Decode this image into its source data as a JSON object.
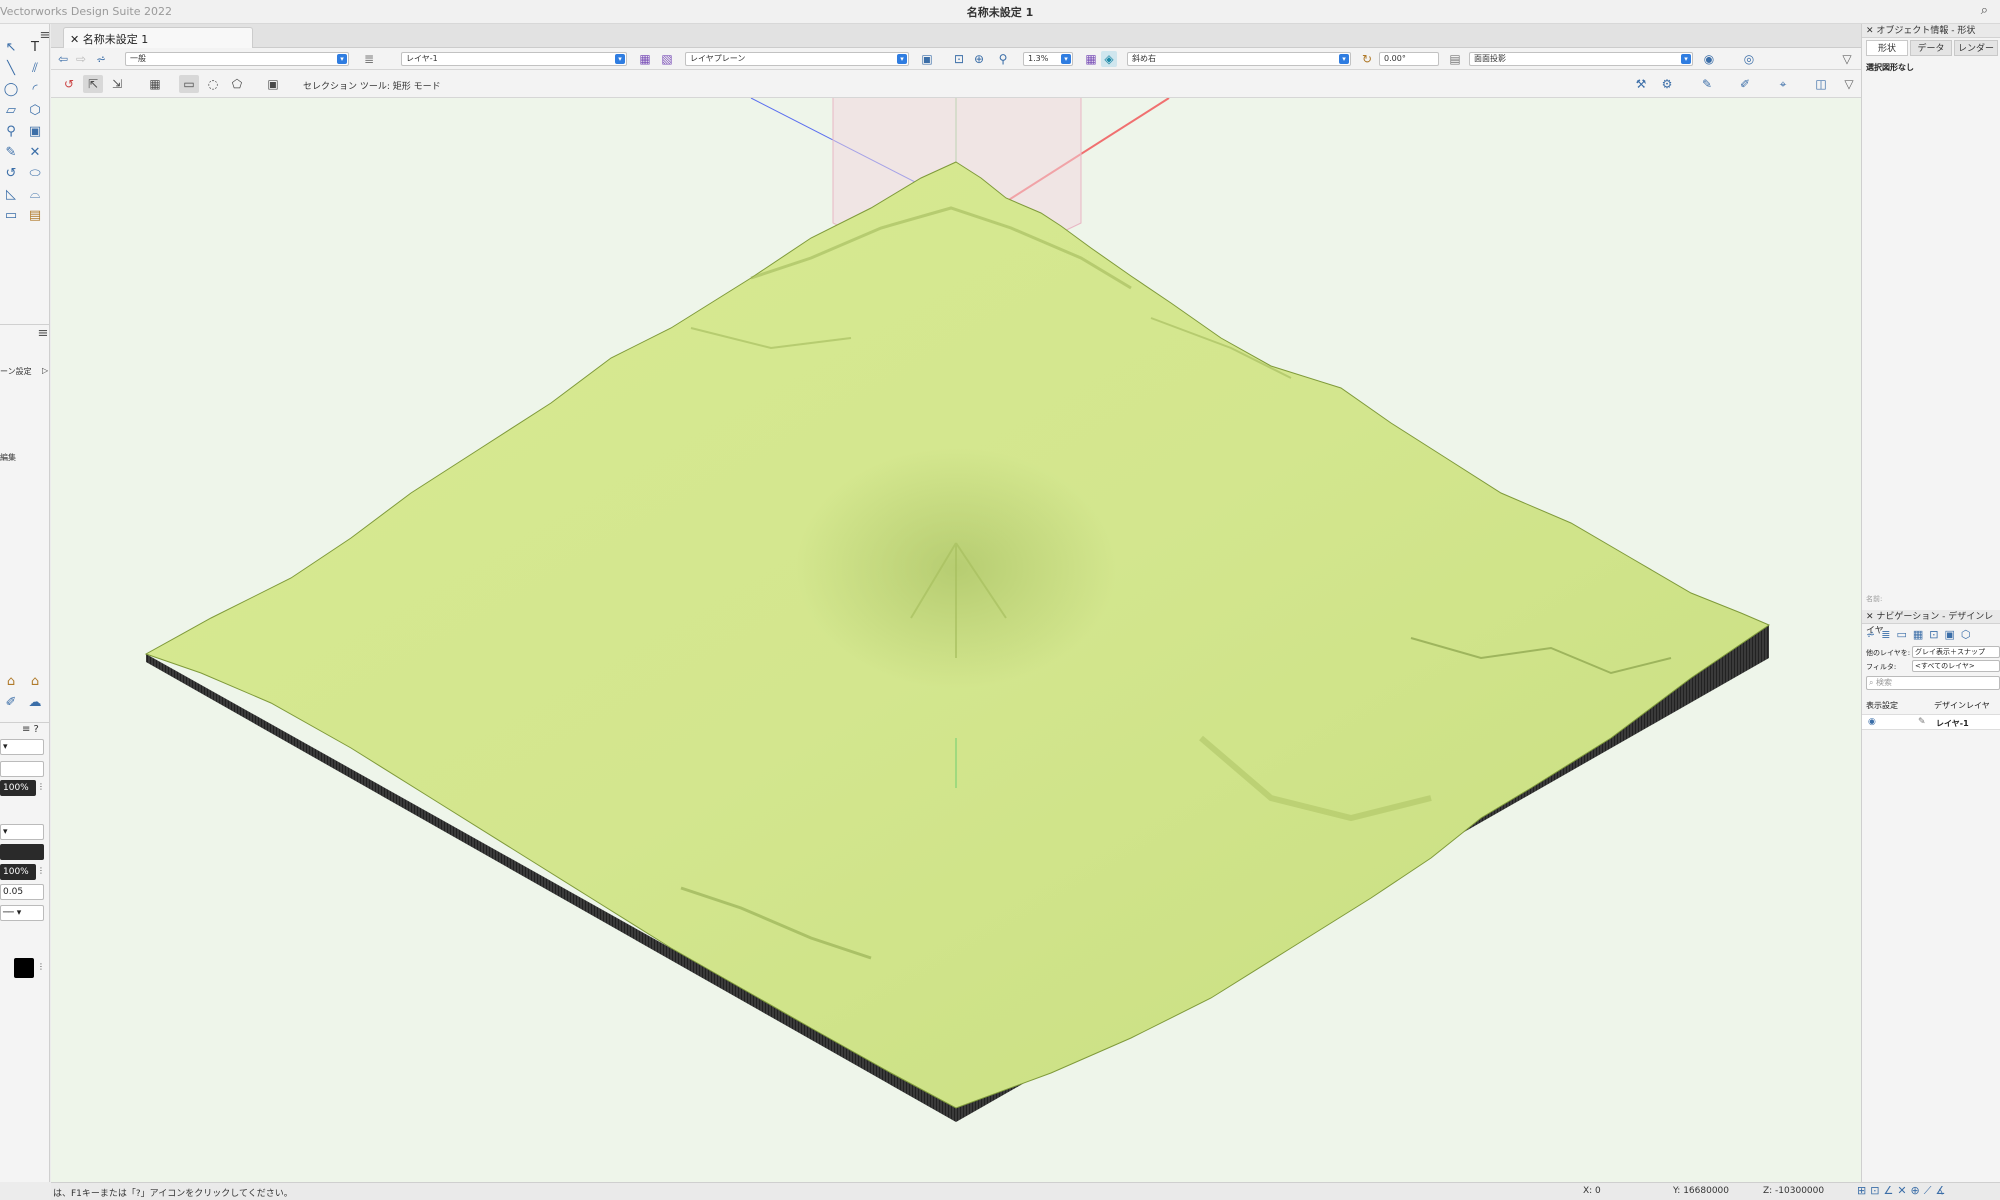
{
  "app": {
    "title": "Vectorworks Design Suite 2022",
    "document_title": "名称未設定 1"
  },
  "tab": {
    "label": "名称未設定 1"
  },
  "viewbar": {
    "class_value": "一般",
    "layer_value": "レイヤ-1",
    "plane_value": "レイヤプレーン",
    "zoom_value": "1.3%",
    "view_value": "斜め右",
    "angle_value": "0.00°",
    "render_value": "面面投影"
  },
  "modebar": {
    "mode_text": "セレクション ツール: 矩形 モード"
  },
  "leftpanel": {
    "item1": "ーン設定",
    "item2": "編集",
    "opacity1": "100%",
    "opacity2": "100%",
    "line_weight": "0.05"
  },
  "rightpanel": {
    "obj_info_title": "オブジェクト情報 - 形状",
    "tabs": [
      "形状",
      "データ",
      "レンダー"
    ],
    "no_selection": "選択図形なし",
    "name_label": "名前:",
    "nav_title": "ナビゲーション - デザインレイヤ",
    "other_layers_label": "他のレイヤを:",
    "other_layers_value": "グレイ表示＋スナップ",
    "filter_label": "フィルタ:",
    "filter_value": "<すべてのレイヤ>",
    "search_placeholder": "検索",
    "col_display": "表示設定",
    "col_layer": "デザインレイヤ",
    "layer_row": "レイヤ-1"
  },
  "status": {
    "hint": "は、F1キーまたは「?」アイコンをクリックしてください。",
    "x": "X: 0",
    "y": "Y: 16680000",
    "z": "Z: -10300000"
  },
  "colors": {
    "terrain": "#d3e68e",
    "terrain_shadow": "#b9cf70",
    "base_side": "#3a3a3a",
    "canvas_bg": "#eef5ea",
    "accent": "#2f7de1"
  }
}
